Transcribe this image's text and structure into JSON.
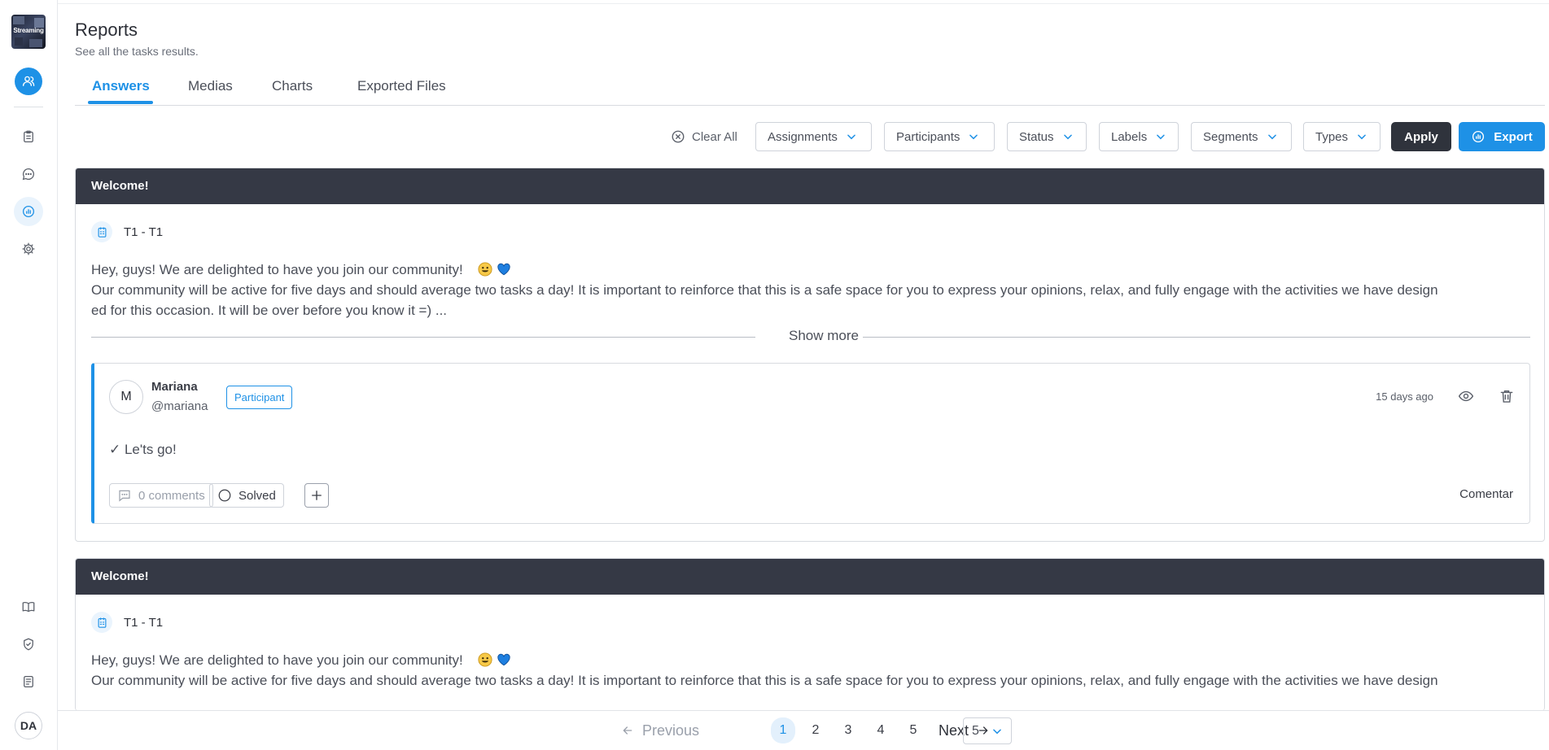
{
  "brand": {
    "label": "Streaming"
  },
  "user": {
    "initials": "DA"
  },
  "header": {
    "title": "Reports",
    "subtitle": "See all the tasks results."
  },
  "tabs": [
    {
      "label": "Answers",
      "active": true
    },
    {
      "label": "Medias",
      "active": false
    },
    {
      "label": "Charts",
      "active": false
    },
    {
      "label": "Exported Files",
      "active": false
    }
  ],
  "filters": {
    "clear_all": "Clear All",
    "dropdowns": [
      "Assignments",
      "Participants",
      "Status",
      "Labels",
      "Segments",
      "Types"
    ],
    "apply": "Apply",
    "export": "Export"
  },
  "cards": [
    {
      "header": "Welcome!",
      "task": "T1 - T1",
      "line1": "Hey, guys! We are delighted to have you join our community!",
      "line2": "Our community will be active for five days and should average two tasks a day! It is important to reinforce that this is a safe space for you to express your opinions, relax, and fully engage with the activities we have design",
      "line3": "ed for this occasion. It will be over before you know it =)  ...",
      "show_more": "Show more",
      "answer": {
        "initial": "M",
        "name": "Mariana",
        "handle": "@mariana",
        "badge": "Participant",
        "time": "15 days ago",
        "text": "✓  Le'ts go!",
        "comments": "0 comments",
        "solved": "Solved",
        "comment_action": "Comentar"
      }
    },
    {
      "header": "Welcome!",
      "task": "T1 - T1",
      "line1": "Hey, guys! We are delighted to have you join our community!",
      "line2": "Our community will be active for five days and should average two tasks a day! It is important to reinforce that this is a safe space for you to express your opinions, relax, and fully engage with the activities we have design"
    }
  ],
  "pagination": {
    "previous": "Previous",
    "next": "Next",
    "pages": [
      "1",
      "2",
      "3",
      "4",
      "5"
    ],
    "current": "1",
    "per_page": "5"
  },
  "colors": {
    "accent": "#1e91e6",
    "dark": "#353945"
  }
}
